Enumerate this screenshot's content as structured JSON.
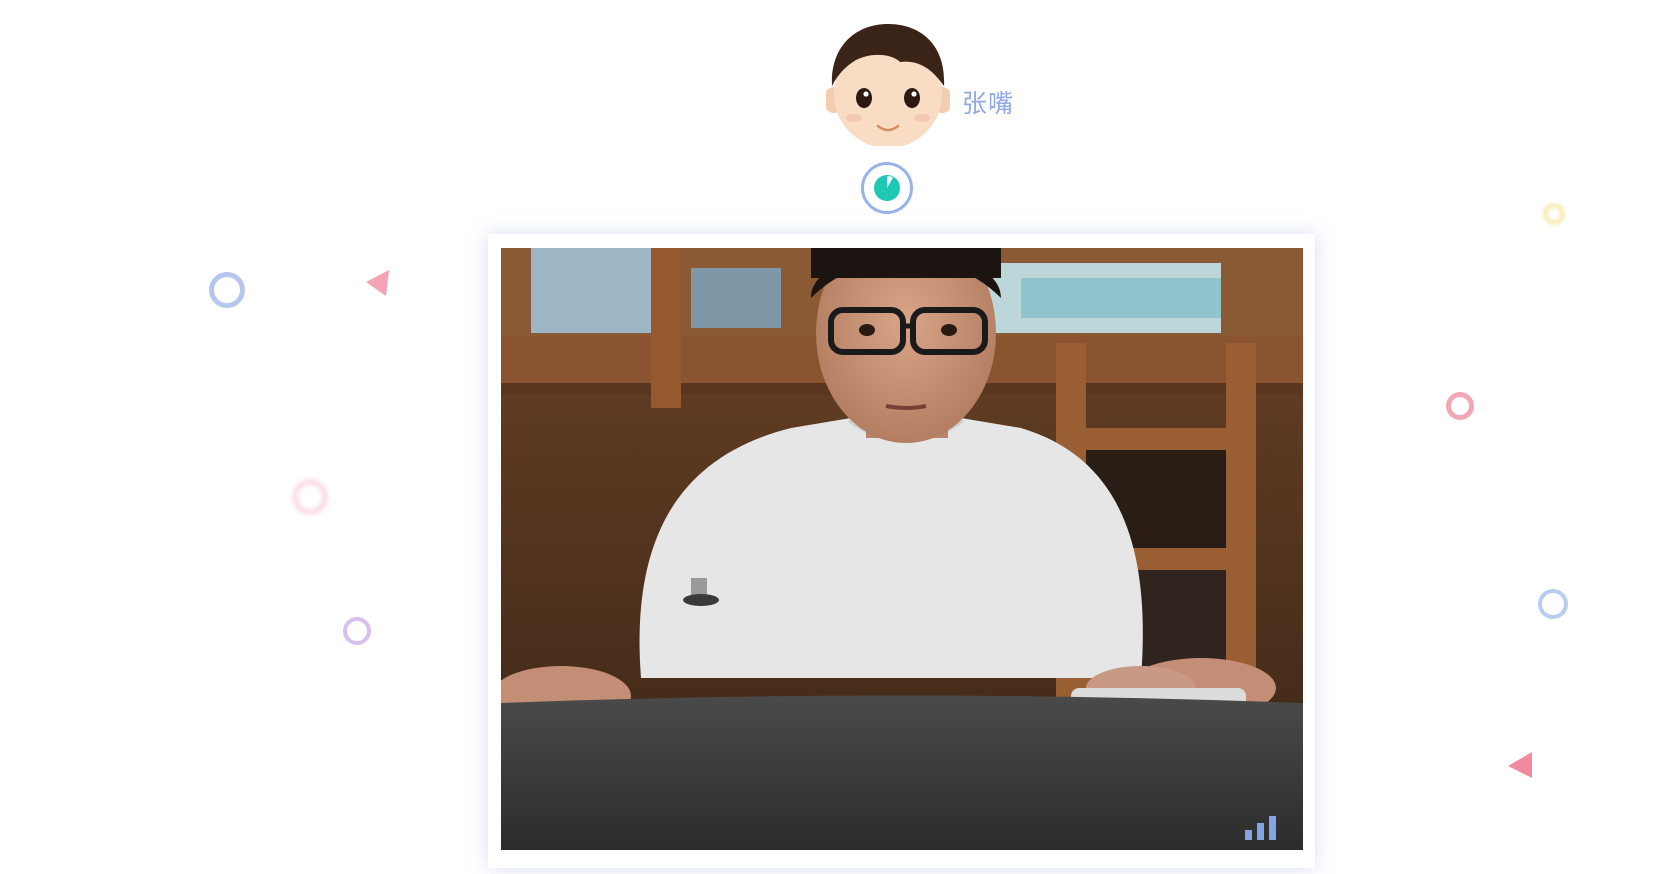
{
  "user": {
    "name": "张嘴",
    "avatar_icon": "cartoon-boy-avatar-icon"
  },
  "timer": {
    "icon": "countdown-timer-icon",
    "ring_color": "#9ab2ea",
    "fill_color": "#1fc8b4"
  },
  "video": {
    "content": "camera-feed-person",
    "signal_icon": "signal-strength-icon"
  },
  "colors": {
    "accent_blue": "#8ea9e6",
    "deco_pink": "#f08aa0",
    "deco_purple": "#c9a9e0",
    "deco_yellow": "#f5e29a"
  }
}
